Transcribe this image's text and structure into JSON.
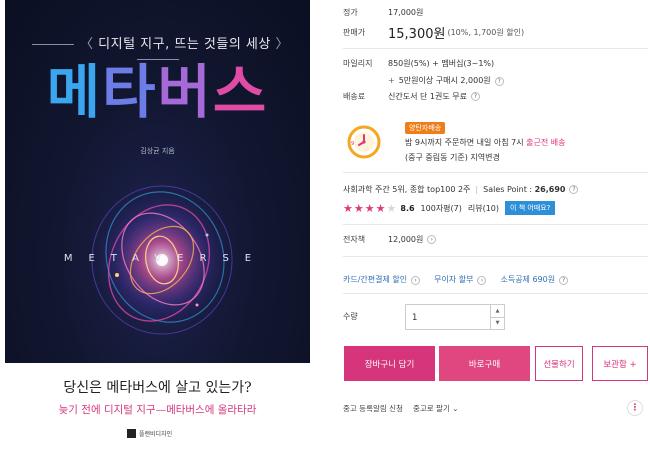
{
  "cover": {
    "subtitle": "디지털 지구, 뜨는 것들의 세상",
    "title_chars": [
      "메",
      "타",
      "버",
      "스"
    ],
    "author": "김상균 지음",
    "metaverse_text": "METAVERSE",
    "question": "당신은 메타버스에 살고 있는가?",
    "tagline": "늦기 전에 디지털 지구—메타버스에 올라타라",
    "publisher": "플랜비디자인"
  },
  "price": {
    "list_label": "정가",
    "list_value": "17,000원",
    "sale_label": "판매가",
    "sale_value": "15,300원",
    "sale_note": "(10%, 1,700원 할인)"
  },
  "mileage": {
    "label": "마일리지",
    "line1": "850원(5%) + 멤버십(3~1%)",
    "line2_plus": "+",
    "line2": "5만원이상 구매시 2,000원"
  },
  "shipping": {
    "label": "배송료",
    "value": "신간도서 단 1권도 무료"
  },
  "delivery": {
    "badge": "양탄자배송",
    "line1_prefix": "밤 9시까지 주문하면 내일 아침 7시",
    "line1_highlight": "출근전 배송",
    "line2": "(중구 중림동 기준) 지역변경"
  },
  "ranking": {
    "text": "사회과학 주간 5위, 종합 top100 2주",
    "sep": "|",
    "sales_label": "Sales Point :",
    "sales_value": "26,690",
    "rating": 4.3,
    "score": "8.6",
    "review1": "100자평(7)",
    "review2": "리뷰(10)",
    "look_button": "이 책 어때요?"
  },
  "ebook": {
    "label": "전자책",
    "value": "12,000원"
  },
  "discounts": [
    "카드/간편결제 할인",
    "무이자 할부",
    "소득공제 690원"
  ],
  "quantity": {
    "label": "수량",
    "value": "1"
  },
  "buttons": {
    "cart": "장바구니 담기",
    "buy": "바로구매",
    "gift": "선물하기",
    "keep": "보관함 +"
  },
  "bottom": {
    "used_alert": "중고 등록알림 신청",
    "used_sell": "중고로 팔기"
  },
  "colors": {
    "accent": "#d6347b",
    "badge": "#ef7d1a",
    "link": "#2f6fb6",
    "look_button": "#2d8fd8"
  }
}
